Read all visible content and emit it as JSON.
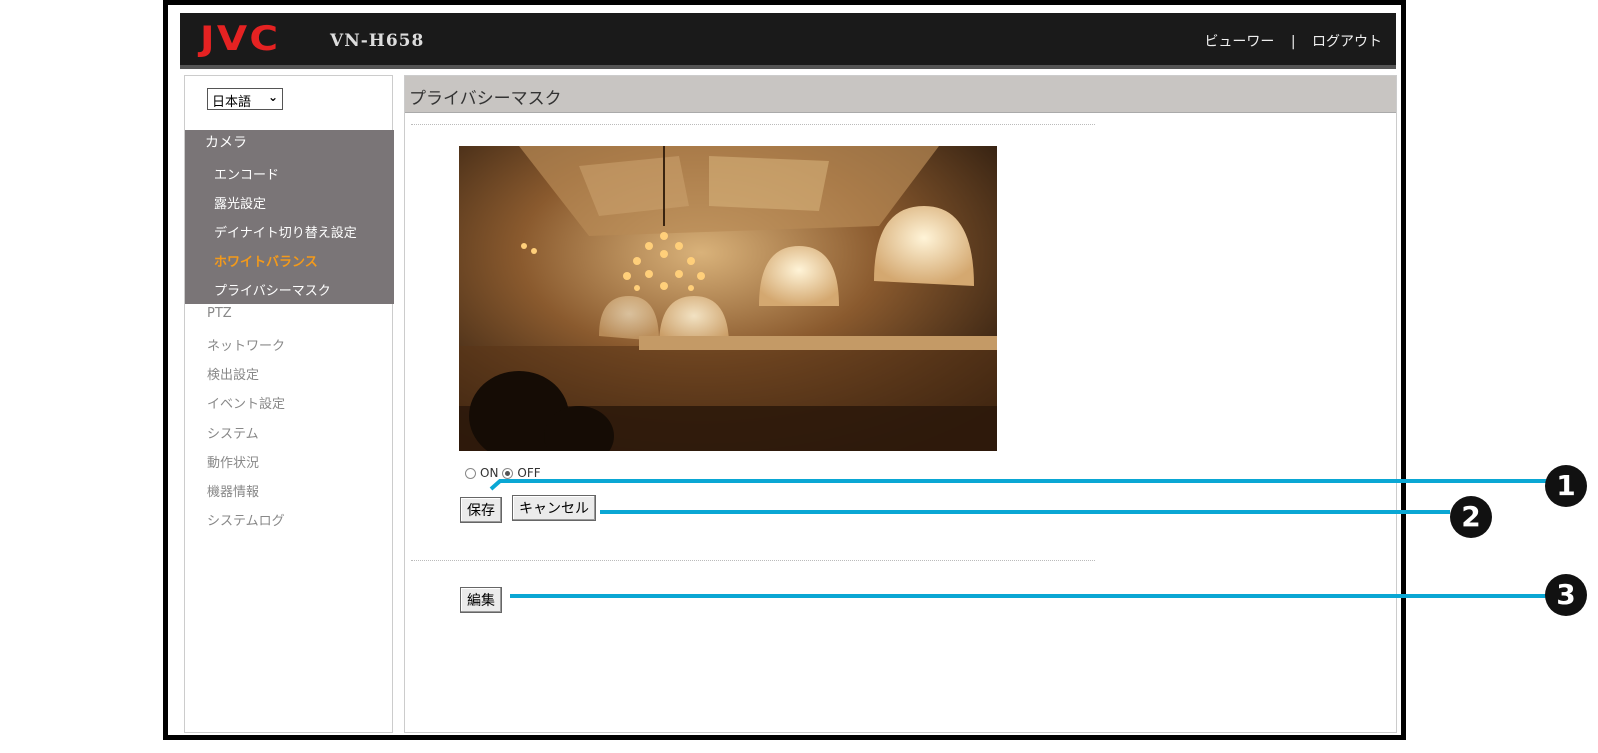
{
  "header": {
    "logo": "JVC",
    "model": "VN-H658",
    "viewer_link": "ビューワー",
    "separator": "|",
    "logout_link": "ログアウト"
  },
  "sidebar": {
    "language": "日本語",
    "camera_group": {
      "title": "カメラ",
      "items": [
        "エンコード",
        "露光設定",
        "デイナイト切り替え設定",
        "ホワイトバランス",
        "プライバシーマスク"
      ],
      "active_item": "ホワイトバランス"
    },
    "items": [
      "PTZ",
      "ネットワーク",
      "検出設定",
      "イベント設定",
      "システム",
      "動作状況",
      "機器情報",
      "システムログ"
    ]
  },
  "main": {
    "title": "プライバシーマスク",
    "radio_on_label": "ON",
    "radio_off_label": "OFF",
    "selected": "OFF",
    "save_button": "保存",
    "cancel_button": "キャンセル",
    "edit_button": "編集"
  },
  "callouts": [
    "1",
    "2",
    "3"
  ],
  "colors": {
    "header_bg": "#1a1a1a",
    "logo_red": "#e52222",
    "camera_group_bg": "#7a7577",
    "active_orange": "#f39a1b",
    "callout_line": "#0aa7d4"
  }
}
